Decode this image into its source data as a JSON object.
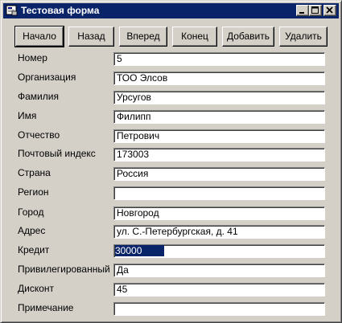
{
  "window": {
    "title": "Тестовая форма",
    "title_bar_color": "#0a246a",
    "face_color": "#d4d0c8"
  },
  "caption_buttons": [
    {
      "name": "minimize",
      "icon": "minimize-icon"
    },
    {
      "name": "maximize",
      "icon": "maximize-icon"
    },
    {
      "name": "close",
      "icon": "close-icon"
    }
  ],
  "toolbar": {
    "first": "Начало",
    "prev": "Назад",
    "next": "Вперед",
    "last": "Конец",
    "add": "Добавить",
    "delete": "Удалить"
  },
  "fields": [
    {
      "label": "Номер",
      "value": "5"
    },
    {
      "label": "Организация",
      "value": "ТОО Элсов"
    },
    {
      "label": "Фамилия",
      "value": "Урсугов"
    },
    {
      "label": "Имя",
      "value": "Филипп"
    },
    {
      "label": "Отчество",
      "value": "Петрович"
    },
    {
      "label": "Почтовый индекс",
      "value": "173003"
    },
    {
      "label": "Страна",
      "value": "Россия"
    },
    {
      "label": "Регион",
      "value": ""
    },
    {
      "label": "Город",
      "value": "Новгород"
    },
    {
      "label": "Адрес",
      "value": "ул. С.-Петербургская, д. 41"
    },
    {
      "label": "Кредит",
      "value": "30000",
      "selected": true
    },
    {
      "label": "Привилегированный",
      "value": "Да"
    },
    {
      "label": "Дисконт",
      "value": "45"
    },
    {
      "label": "Примечание",
      "value": ""
    }
  ]
}
